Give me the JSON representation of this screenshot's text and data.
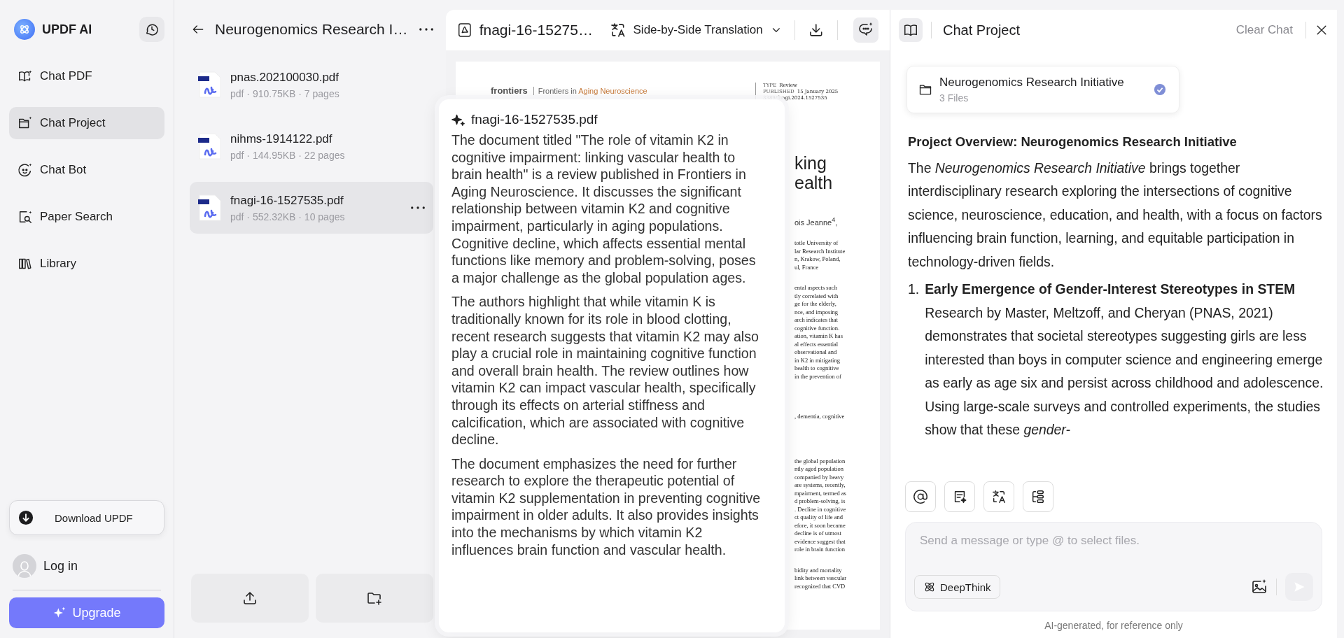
{
  "sidebar": {
    "brand": "UPDF AI",
    "items": [
      {
        "label": "Chat PDF",
        "selected": false
      },
      {
        "label": "Chat Project",
        "selected": true
      },
      {
        "label": "Chat Bot",
        "selected": false
      },
      {
        "label": "Paper Search",
        "selected": false
      },
      {
        "label": "Library",
        "selected": false
      }
    ],
    "download_button": "Download UPDF",
    "login": "Log in",
    "upgrade_button": "Upgrade"
  },
  "files": {
    "title": "Neurogenomics Research I…",
    "items": [
      {
        "name": "pnas.202100030.pdf",
        "meta": "pdf · 910.75KB · 7 pages",
        "selected": false
      },
      {
        "name": "nihms-1914122.pdf",
        "meta": "pdf · 144.95KB · 22 pages",
        "selected": false
      },
      {
        "name": "fnagi-16-1527535.pdf",
        "meta": "pdf · 552.32KB · 10 pages",
        "selected": true
      }
    ]
  },
  "viewer": {
    "file_title": "fnagi-16-15275…",
    "mode": "Side-by-Side Translation",
    "page": {
      "publisher": "frontiers",
      "journal_prefix": "Frontiers in",
      "journal": "Aging Neuroscience",
      "type_label": "TYPE",
      "type": "Review",
      "published_label": "PUBLISHED",
      "published": "15 January 2025",
      "doi": "3389/fnagi.2024.1527535",
      "title_fragments": [
        "king",
        "ealth"
      ],
      "author_fragment": "ois Jeanne$^{4}$,",
      "fragment_groups": [
        [
          "totle University of",
          "lar Research Institute",
          "n, Krakow, Poland,",
          "ul, France"
        ],
        [
          "ental aspects such",
          "tly correlated with",
          "ge for the elderly,",
          "nce, and imposing",
          "arch indicates that",
          "cognitive function.",
          "ation, vitamin K has",
          "al effects essential",
          "observational and",
          "in K2 in mitigating",
          "health to cognitive",
          "in the prevention of"
        ],
        [
          ", dementia, cognitive"
        ],
        [
          "the global population",
          "ntly aged population",
          "companied by heavy",
          "are systems, recently,",
          "mpairment, termed as",
          "d problem-solving, is",
          ". Decline in cognitive",
          "ct quality of life and",
          "efore, it soon became",
          "decline is of utmost",
          "evidence suggest that",
          "role in brain function"
        ],
        [
          "bidity and mortality",
          "link between vascular",
          "recognized that CVD"
        ]
      ]
    }
  },
  "summary_popup": {
    "title": "fnagi-16-1527535.pdf",
    "paragraphs": [
      "The document titled \"The role of vitamin K2 in cognitive impairment: linking vascular health to brain health\" is a review published in Frontiers in Aging Neuroscience. It discusses the significant relationship between vitamin K2 and cognitive impairment, particularly in aging populations. Cognitive decline, which affects essential mental functions like memory and problem-solving, poses a major challenge as the global population ages.",
      "The authors highlight that while vitamin K is traditionally known for its role in blood clotting, recent research suggests that vitamin K2 may also play a crucial role in maintaining cognitive function and overall brain health. The review outlines how vitamin K2 can impact vascular health, specifically through its effects on arterial stiffness and calcification, which are associated with cognitive decline.",
      "The document emphasizes the need for further research to explore the therapeutic potential of vitamin K2 supplementation in preventing cognitive impairment in older adults. It also provides insights into the mechanisms by which vitamin K2 influences brain function and vascular health."
    ]
  },
  "chat": {
    "title": "Chat Project",
    "clear_button": "Clear Chat",
    "project": {
      "name": "Neurogenomics Research Initiative",
      "count": "3 Files",
      "checked": true
    },
    "heading": "Project Overview: Neurogenomics Research Initiative",
    "intro": "The *Neurogenomics Research Initiative* brings together interdisciplinary research exploring the intersections of cognitive science, neuroscience, education, and health, with a focus on factors influencing brain function, learning, and equitable participation in technology-driven fields.",
    "list": [
      {
        "number": "1.",
        "title": "Early Emergence of Gender-Interest Stereotypes in STEM",
        "body": "Research by Master, Meltzoff, and Cheryan (PNAS, 2021) demonstrates that societal stereotypes suggesting girls are less interested than boys in computer science and engineering emerge as early as age six and persist across childhood and adolescence. Using large-scale surveys and controlled experiments, the studies show that these *gender-*"
      }
    ],
    "placeholder": "Send a message or type @ to select files.",
    "deepthink_button": "DeepThink",
    "footer": "AI-generated, for reference only"
  }
}
